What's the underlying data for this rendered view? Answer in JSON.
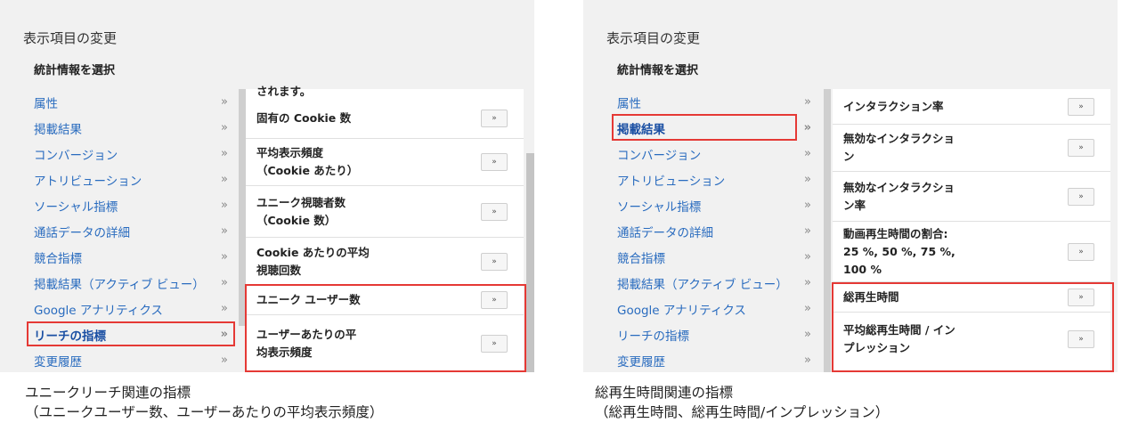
{
  "left": {
    "title": "表示項目の変更",
    "subtitle": "統計情報を選択",
    "categories": [
      {
        "label": "属性",
        "arrow": "»"
      },
      {
        "label": "掲載結果",
        "arrow": "»"
      },
      {
        "label": "コンバージョン",
        "arrow": "»"
      },
      {
        "label": "アトリビューション",
        "arrow": "»"
      },
      {
        "label": "ソーシャル指標",
        "arrow": "»"
      },
      {
        "label": "通話データの詳細",
        "arrow": "»"
      },
      {
        "label": "競合指標",
        "arrow": "»"
      },
      {
        "label": "掲載結果（アクティブ ビュー）",
        "arrow": "»"
      },
      {
        "label": "Google アナリティクス",
        "arrow": "»"
      },
      {
        "label": "リーチの指標",
        "arrow": "»"
      },
      {
        "label": "変更履歴",
        "arrow": "»"
      }
    ],
    "clipped_text": "されます。",
    "metrics": [
      {
        "label": "固有の Cookie 数",
        "button": "»"
      },
      {
        "label": "平均表示頻度\n（Cookie あたり）",
        "button": "»"
      },
      {
        "label": "ユニーク視聴者数\n（Cookie 数）",
        "button": "»"
      },
      {
        "label": "Cookie あたりの平均\n視聴回数",
        "button": "»"
      },
      {
        "label": "ユニーク ユーザー数",
        "button": "»"
      },
      {
        "label": "ユーザーあたりの平\n均表示頻度",
        "button": "»"
      }
    ],
    "caption": "ユニークリーチ関連の指標\n（ユニークユーザー数、ユーザーあたりの平均表示頻度）"
  },
  "right": {
    "title": "表示項目の変更",
    "subtitle": "統計情報を選択",
    "categories": [
      {
        "label": "属性",
        "arrow": "»"
      },
      {
        "label": "掲載結果",
        "arrow": "»"
      },
      {
        "label": "コンバージョン",
        "arrow": "»"
      },
      {
        "label": "アトリビューション",
        "arrow": "»"
      },
      {
        "label": "ソーシャル指標",
        "arrow": "»"
      },
      {
        "label": "通話データの詳細",
        "arrow": "»"
      },
      {
        "label": "競合指標",
        "arrow": "»"
      },
      {
        "label": "掲載結果（アクティブ ビュー）",
        "arrow": "»"
      },
      {
        "label": "Google アナリティクス",
        "arrow": "»"
      },
      {
        "label": "リーチの指標",
        "arrow": "»"
      },
      {
        "label": "変更履歴",
        "arrow": "»"
      }
    ],
    "metrics": [
      {
        "label": "インタラクション率",
        "button": "»"
      },
      {
        "label": "無効なインタラクショ\nン",
        "button": "»"
      },
      {
        "label": "無効なインタラクショ\nン率",
        "button": "»"
      },
      {
        "label": "動画再生時間の割合:\n25 %, 50 %, 75 %,\n100 %",
        "button": "»"
      },
      {
        "label": "総再生時間",
        "button": "»"
      },
      {
        "label": "平均総再生時間 / イン\nプレッション",
        "button": "»"
      }
    ],
    "caption": "総再生時間関連の指標\n（総再生時間、総再生時間/インプレッション）"
  },
  "colors": {
    "highlight": "#e53935",
    "link": "#2a6cbf",
    "panel_bg": "#f1f1f1"
  }
}
